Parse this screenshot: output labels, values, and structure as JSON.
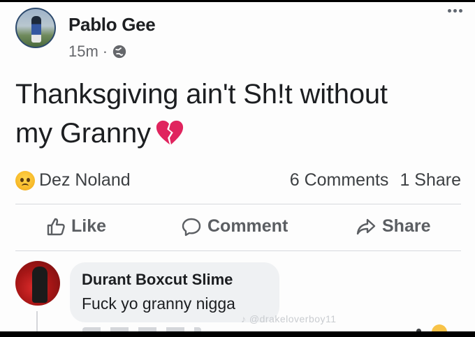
{
  "post": {
    "author": "Pablo Gee",
    "time": "15m",
    "separator": "·",
    "privacy_icon": "globe-icon",
    "text_line1": "Thanksgiving ain't Sh!t without",
    "text_line2": "my Granny",
    "text_emoji": "broken-heart-icon"
  },
  "engagement": {
    "reaction_icon": "sad-face-icon",
    "reactor_name": "Dez Noland",
    "comments_count": "6 Comments",
    "shares_count": "1 Share"
  },
  "actions": {
    "like_label": "Like",
    "comment_label": "Comment",
    "share_label": "Share"
  },
  "comment": {
    "author": "Durant Boxcut Slime",
    "text": "Fuck yo granny nigga"
  },
  "watermark": {
    "text": "♪ @drakeloverboy11"
  },
  "colors": {
    "text_primary": "#1c1e21",
    "text_secondary": "#65676b",
    "action_gray": "#5b5e62",
    "broken_heart": "#e0245e",
    "reaction_yellow": "#f7b928",
    "bubble_bg": "#eff1f3"
  }
}
